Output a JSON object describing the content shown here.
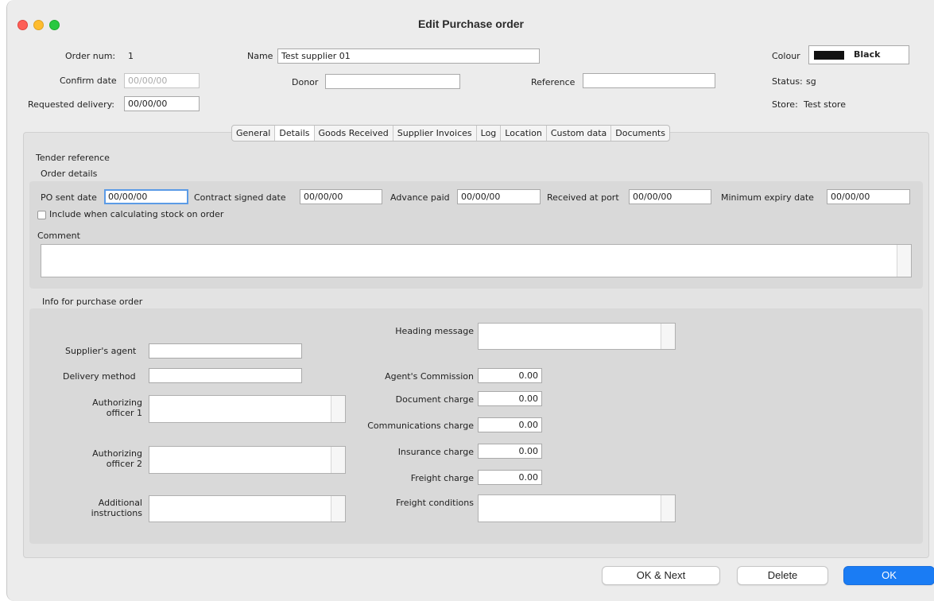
{
  "window": {
    "title": "Edit Purchase order"
  },
  "header": {
    "order_num_label": "Order num:",
    "order_num": "1",
    "name_label": "Name",
    "name_value": "Test supplier 01",
    "colour_label": "Colour",
    "colour_name": "Black",
    "colour_hex": "#111111",
    "confirm_date_label": "Confirm date",
    "confirm_date": "00/00/00",
    "donor_label": "Donor",
    "donor_value": "",
    "reference_label": "Reference",
    "reference_value": "",
    "status_label": "Status:",
    "status_value": "sg",
    "requested_delivery_label": "Requested delivery:",
    "requested_delivery": "00/00/00",
    "store_label": "Store:",
    "store_value": "Test store"
  },
  "tabs": [
    {
      "label": "General"
    },
    {
      "label": "Details"
    },
    {
      "label": "Goods Received"
    },
    {
      "label": "Supplier Invoices"
    },
    {
      "label": "Log"
    },
    {
      "label": "Location"
    },
    {
      "label": "Custom data"
    },
    {
      "label": "Documents"
    }
  ],
  "details": {
    "tender_reference_label": "Tender reference",
    "order_details_label": "Order details",
    "po_sent_date_label": "PO sent date",
    "po_sent_date": "00/00/00",
    "contract_signed_label": "Contract signed date",
    "contract_signed_date": "00/00/00",
    "advance_paid_label": "Advance paid",
    "advance_paid_date": "00/00/00",
    "received_at_port_label": "Received at port",
    "received_at_port_date": "00/00/00",
    "min_expiry_label": "Minimum expiry date",
    "min_expiry_date": "00/00/00",
    "include_stock_label": "Include when calculating stock on order",
    "comment_label": "Comment",
    "info_label": "Info for purchase order",
    "suppliers_agent_label": "Supplier's agent",
    "delivery_method_label": "Delivery method",
    "auth_officer_1_line1": "Authorizing",
    "auth_officer_1_line2": "officer 1",
    "auth_officer_2_line1": "Authorizing",
    "auth_officer_2_line2": "officer  2",
    "additional_line1": "Additional",
    "additional_line2": "instructions",
    "heading_message_label": "Heading message",
    "agents_commission_label": "Agent's Commission",
    "agents_commission": "0.00",
    "document_charge_label": "Document charge",
    "document_charge": "0.00",
    "communications_charge_label": "Communications charge",
    "communications_charge": "0.00",
    "insurance_charge_label": "Insurance charge",
    "insurance_charge": "0.00",
    "freight_charge_label": "Freight charge",
    "freight_charge": "0.00",
    "freight_conditions_label": "Freight conditions"
  },
  "buttons": {
    "ok_next": "OK & Next",
    "delete": "Delete",
    "ok": "OK"
  },
  "colors": {
    "accent": "#1a7cf4",
    "focus_ring": "#5b9be6"
  }
}
